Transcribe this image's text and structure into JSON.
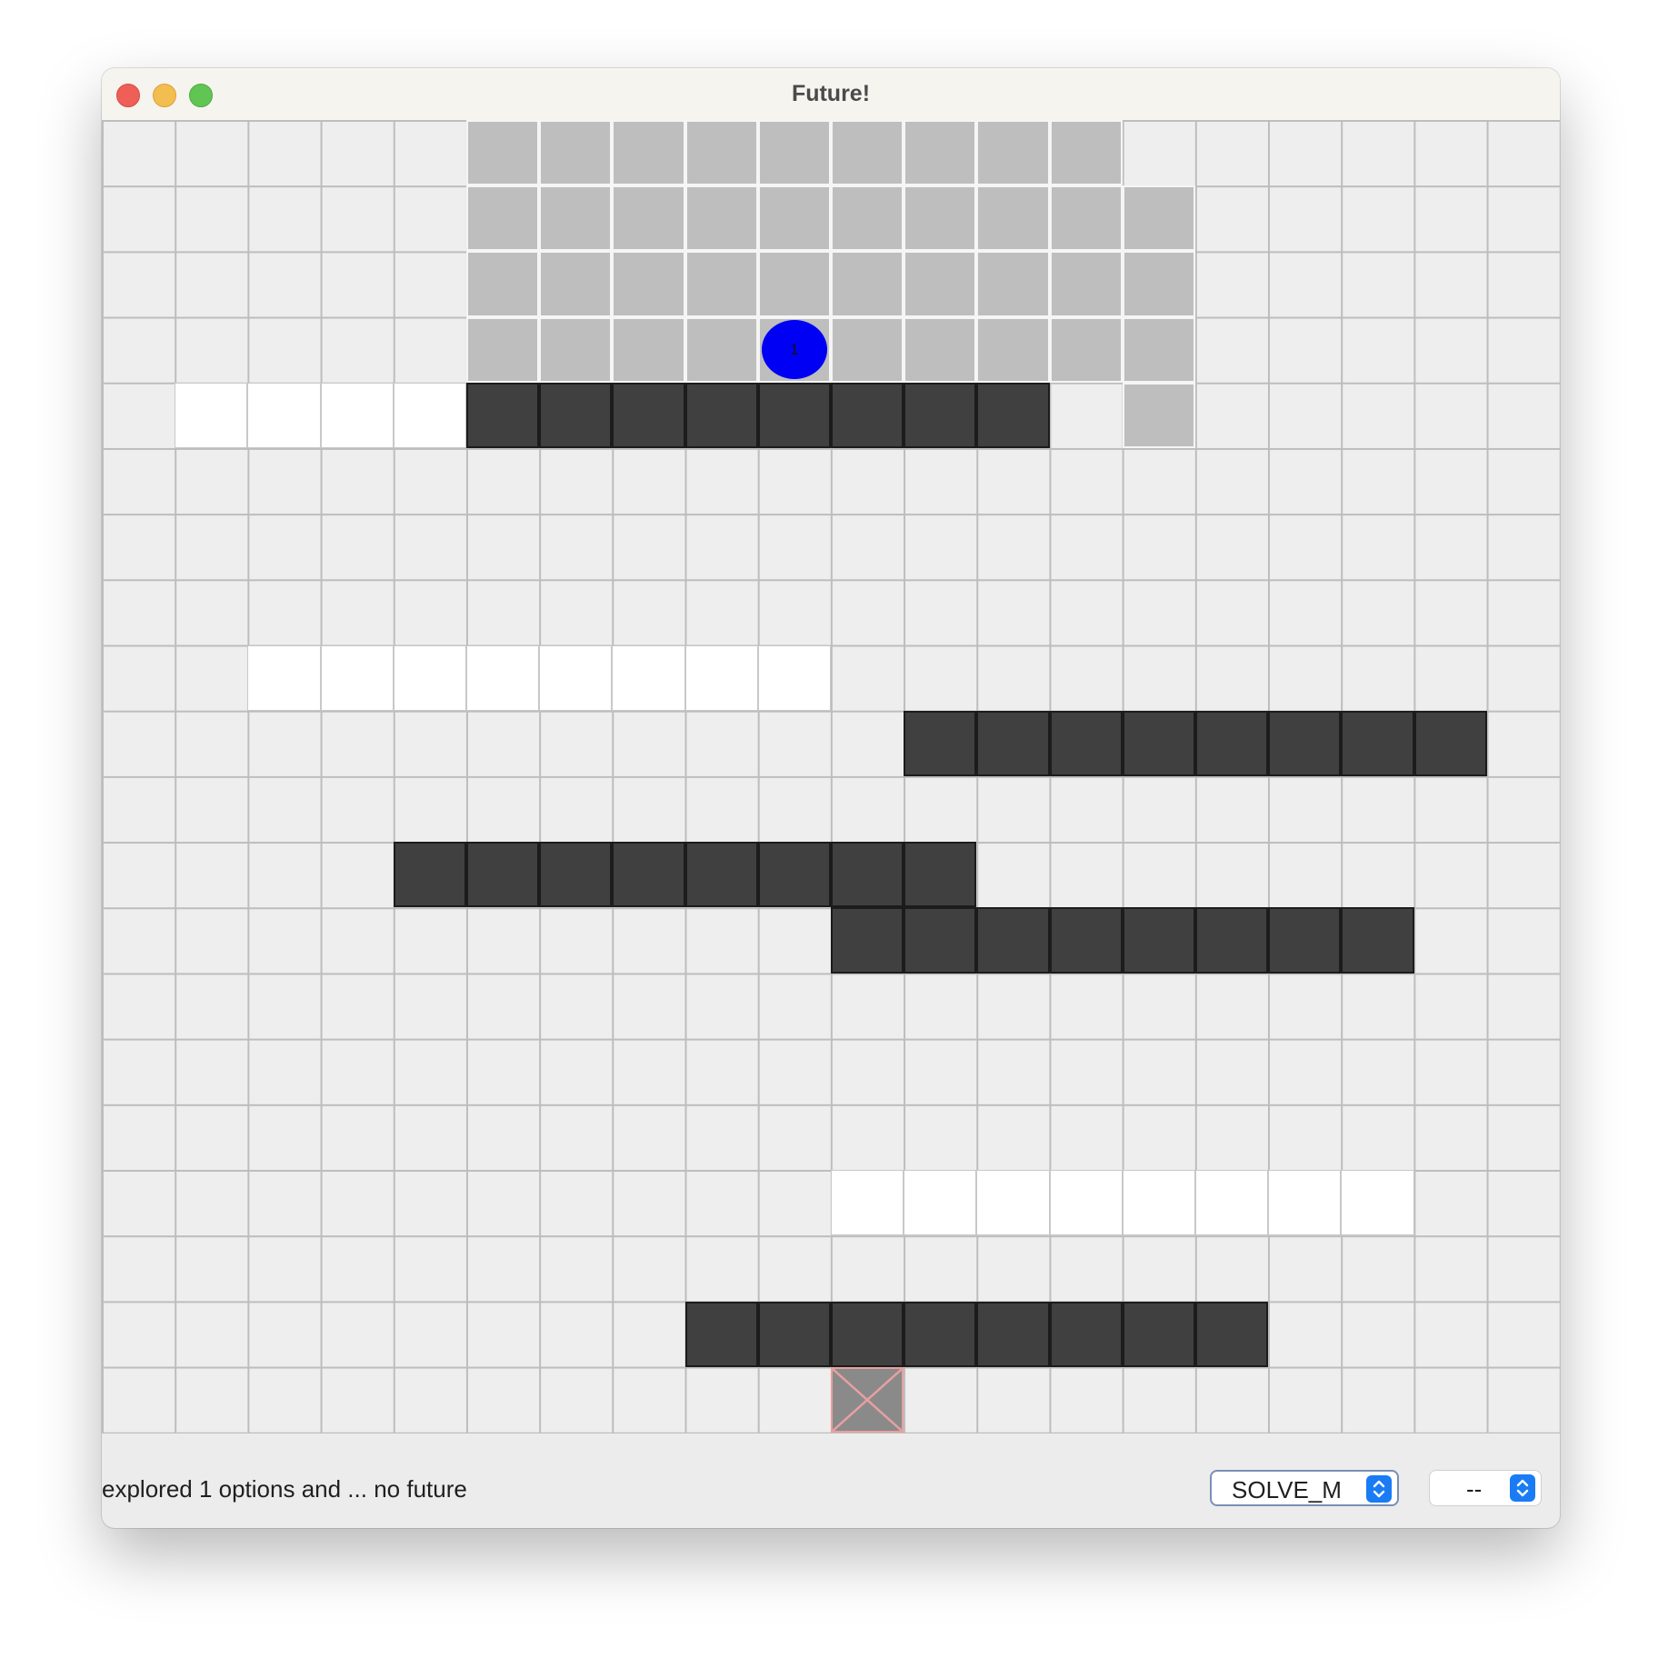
{
  "window": {
    "title": "Future!"
  },
  "board": {
    "columns": 20,
    "rows": 20,
    "light_tiles": [
      [
        5,
        0
      ],
      [
        6,
        0
      ],
      [
        7,
        0
      ],
      [
        8,
        0
      ],
      [
        9,
        0
      ],
      [
        10,
        0
      ],
      [
        11,
        0
      ],
      [
        12,
        0
      ],
      [
        13,
        0
      ],
      [
        5,
        1
      ],
      [
        6,
        1
      ],
      [
        7,
        1
      ],
      [
        8,
        1
      ],
      [
        9,
        1
      ],
      [
        10,
        1
      ],
      [
        11,
        1
      ],
      [
        12,
        1
      ],
      [
        13,
        1
      ],
      [
        14,
        1
      ],
      [
        5,
        2
      ],
      [
        6,
        2
      ],
      [
        7,
        2
      ],
      [
        8,
        2
      ],
      [
        9,
        2
      ],
      [
        10,
        2
      ],
      [
        11,
        2
      ],
      [
        12,
        2
      ],
      [
        13,
        2
      ],
      [
        14,
        2
      ],
      [
        5,
        3
      ],
      [
        6,
        3
      ],
      [
        7,
        3
      ],
      [
        8,
        3
      ],
      [
        9,
        3
      ],
      [
        10,
        3
      ],
      [
        11,
        3
      ],
      [
        12,
        3
      ],
      [
        13,
        3
      ],
      [
        14,
        3
      ],
      [
        14,
        4
      ]
    ],
    "white_tiles": [
      [
        1,
        4
      ],
      [
        2,
        4
      ],
      [
        3,
        4
      ],
      [
        4,
        4
      ],
      [
        2,
        8
      ],
      [
        3,
        8
      ],
      [
        4,
        8
      ],
      [
        5,
        8
      ],
      [
        6,
        8
      ],
      [
        7,
        8
      ],
      [
        8,
        8
      ],
      [
        9,
        8
      ],
      [
        10,
        16
      ],
      [
        11,
        16
      ],
      [
        12,
        16
      ],
      [
        13,
        16
      ],
      [
        14,
        16
      ],
      [
        15,
        16
      ],
      [
        16,
        16
      ],
      [
        17,
        16
      ]
    ],
    "dark_tiles": [
      [
        5,
        4
      ],
      [
        6,
        4
      ],
      [
        7,
        4
      ],
      [
        8,
        4
      ],
      [
        9,
        4
      ],
      [
        10,
        4
      ],
      [
        11,
        4
      ],
      [
        12,
        4
      ],
      [
        11,
        9
      ],
      [
        12,
        9
      ],
      [
        13,
        9
      ],
      [
        14,
        9
      ],
      [
        15,
        9
      ],
      [
        16,
        9
      ],
      [
        17,
        9
      ],
      [
        18,
        9
      ],
      [
        4,
        11
      ],
      [
        5,
        11
      ],
      [
        6,
        11
      ],
      [
        7,
        11
      ],
      [
        8,
        11
      ],
      [
        9,
        11
      ],
      [
        10,
        11
      ],
      [
        11,
        11
      ],
      [
        10,
        12
      ],
      [
        11,
        12
      ],
      [
        12,
        12
      ],
      [
        13,
        12
      ],
      [
        14,
        12
      ],
      [
        15,
        12
      ],
      [
        16,
        12
      ],
      [
        17,
        12
      ],
      [
        8,
        18
      ],
      [
        9,
        18
      ],
      [
        10,
        18
      ],
      [
        11,
        18
      ],
      [
        12,
        18
      ],
      [
        13,
        18
      ],
      [
        14,
        18
      ],
      [
        15,
        18
      ]
    ],
    "goal": [
      10,
      19
    ],
    "agent": {
      "position": [
        9,
        3
      ],
      "label": "1",
      "color": "#0000f5"
    }
  },
  "status": {
    "text": "explored 1 options and ... no future"
  },
  "controls": {
    "mode_select": {
      "value": "SOLVE_M"
    },
    "speed_select": {
      "value": "--"
    }
  },
  "colors": {
    "light_tile": "#bebebe",
    "white_tile": "#ffffff",
    "dark_tile": "#404040",
    "goal_cross": "#e7a0a0",
    "agent": "#0000f5",
    "stepper": "#1a7cf5"
  }
}
